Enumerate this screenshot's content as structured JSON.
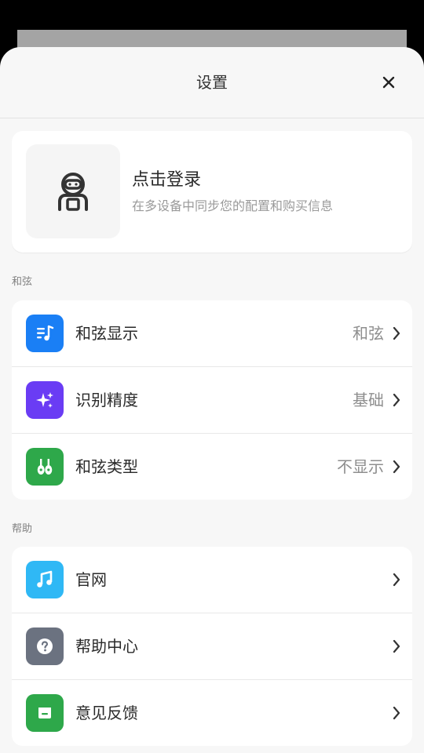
{
  "sheet": {
    "title": "设置",
    "close_icon": "close-icon"
  },
  "login": {
    "title": "点击登录",
    "subtitle": "在多设备中同步您的配置和购买信息",
    "avatar_icon": "astronaut-icon"
  },
  "sections": [
    {
      "label": "和弦",
      "items": [
        {
          "label": "和弦显示",
          "value": "和弦",
          "icon": "music-list-icon",
          "color": "#1a7ff5"
        },
        {
          "label": "识别精度",
          "value": "基础",
          "icon": "sparkles-icon",
          "color": "#6a3cf4"
        },
        {
          "label": "和弦类型",
          "value": "不显示",
          "icon": "guitar-icon",
          "color": "#2ea84a"
        }
      ]
    },
    {
      "label": "帮助",
      "items": [
        {
          "label": "官网",
          "value": "",
          "icon": "music-note-icon",
          "color": "#2fb8f5"
        },
        {
          "label": "帮助中心",
          "value": "",
          "icon": "question-icon",
          "color": "#6b7280"
        },
        {
          "label": "意见反馈",
          "value": "",
          "icon": "feedback-icon",
          "color": "#2ea84a"
        }
      ]
    }
  ]
}
